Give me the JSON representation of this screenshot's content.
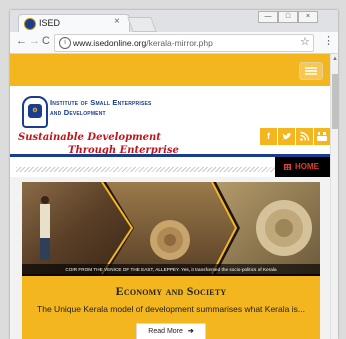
{
  "browser": {
    "tab_title": "ISED",
    "tab_close": "×",
    "url_domain": "www.isedonline.org",
    "url_path": "/kerala-mirror.php",
    "win_controls": [
      "—",
      "□",
      "×"
    ]
  },
  "site": {
    "org_name_line1": "Institute of Small Enterprises",
    "org_name_line2": "and Development",
    "tagline_line1": "Sustainable Development",
    "tagline_line2": "Through Enterprise",
    "social_icons": [
      "facebook-icon",
      "twitter-icon",
      "rss-icon",
      "youtube-icon"
    ],
    "home_label": "HOME",
    "brand_yellow": "#f3b61f",
    "brand_blue": "#1a3d8f",
    "brand_red": "#c0141b"
  },
  "hero": {
    "caption": "COIR FROM THE VENICE OF THE EAST, ALLEPPEY. Yes, it transformed the socio-politics of Kerala"
  },
  "card": {
    "title": "Economy and Society",
    "summary": "The Unique Kerala model of development summarises what Kerala is...",
    "read_more": "Read More"
  }
}
